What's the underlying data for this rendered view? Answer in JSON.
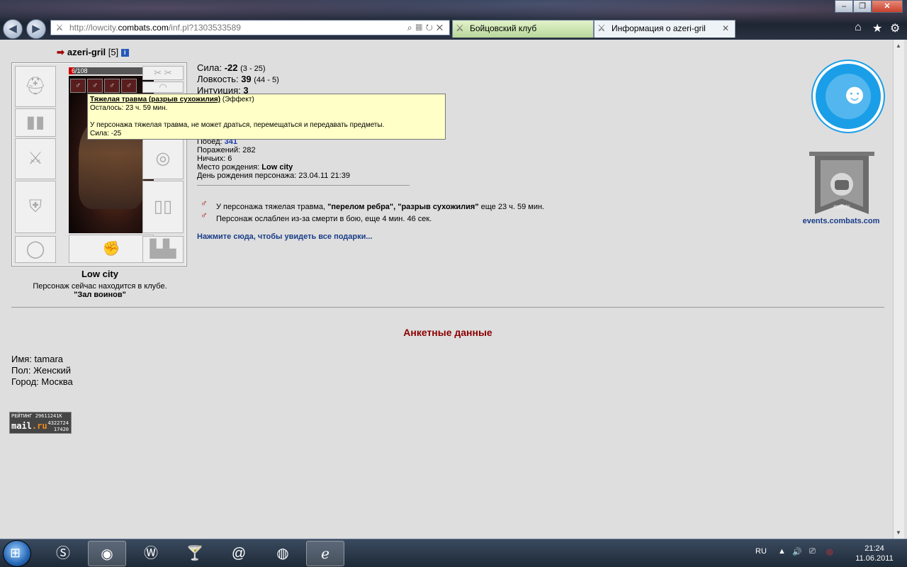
{
  "browser": {
    "url_prefix": "http://lowcity.",
    "url_domain": "combats.com",
    "url_suffix": "/inf.pl?1303533589",
    "tabs": [
      {
        "label": "Бойцовский клуб"
      },
      {
        "label": "Информация о azeri-gril"
      }
    ],
    "window_buttons": {
      "min": "–",
      "max": "❐",
      "close": "✕"
    }
  },
  "character": {
    "nick": "azeri-gril",
    "level": "[5]",
    "hp": "6/108",
    "hp_fraction": 0.06,
    "city": "Low city",
    "location_text": "Персонаж сейчас находится в клубе.",
    "room": "\"Зал воинов\""
  },
  "stats": [
    {
      "label": "Сила: ",
      "value": "-22",
      "range": "(3 - 25)"
    },
    {
      "label": "Ловкость: ",
      "value": "39",
      "range": "(44 - 5)"
    },
    {
      "label": "Интуиция: ",
      "value": "3",
      "range": ""
    }
  ],
  "record": {
    "wins_label": "Побед: ",
    "wins": "341",
    "losses": "Поражений: 282",
    "draws": "Ничьих: 6",
    "birthplace_label": "Место рождения: ",
    "birthplace": "Low city",
    "birthday": "День рождения персонажа: 23.04.11 21:39"
  },
  "trauma": {
    "line1_prefix": "У персонажа тяжелая травма, ",
    "line1_bold": "\"перелом ребра\", \"разрыв сухожилия\"",
    "line1_suffix": " еще 23 ч. 59 мин.",
    "line2": "Персонаж ослаблен из-за смерти в бою, еще 4 мин. 46 сек."
  },
  "gifts_link": "Нажмите сюда, чтобы увидеть все подарки...",
  "tooltip": {
    "title": "Тяжелая травма (разрыв сухожилия)",
    "type": " (Эффект)",
    "remaining": "Осталось: 23 ч. 59 мин.",
    "description": "У персонажа тяжелая травма, не может драться, перемещаться и передавать предметы.",
    "effect": "Сила: -25"
  },
  "events": {
    "badge": "events",
    "link": "events.combats.com"
  },
  "profile": {
    "heading": "Анкетные данные",
    "name": "Имя: tamara",
    "gender": "Пол: Женский",
    "city": "Город: Москва"
  },
  "counter": {
    "line1": "РЕЙТИНГ 29611241К",
    "brand_a": "mail",
    "brand_b": ".ru",
    "num1": "4322724",
    "num2": "17420"
  },
  "taskbar": {
    "lang": "RU",
    "time": "21:24",
    "date": "11.06.2011"
  }
}
